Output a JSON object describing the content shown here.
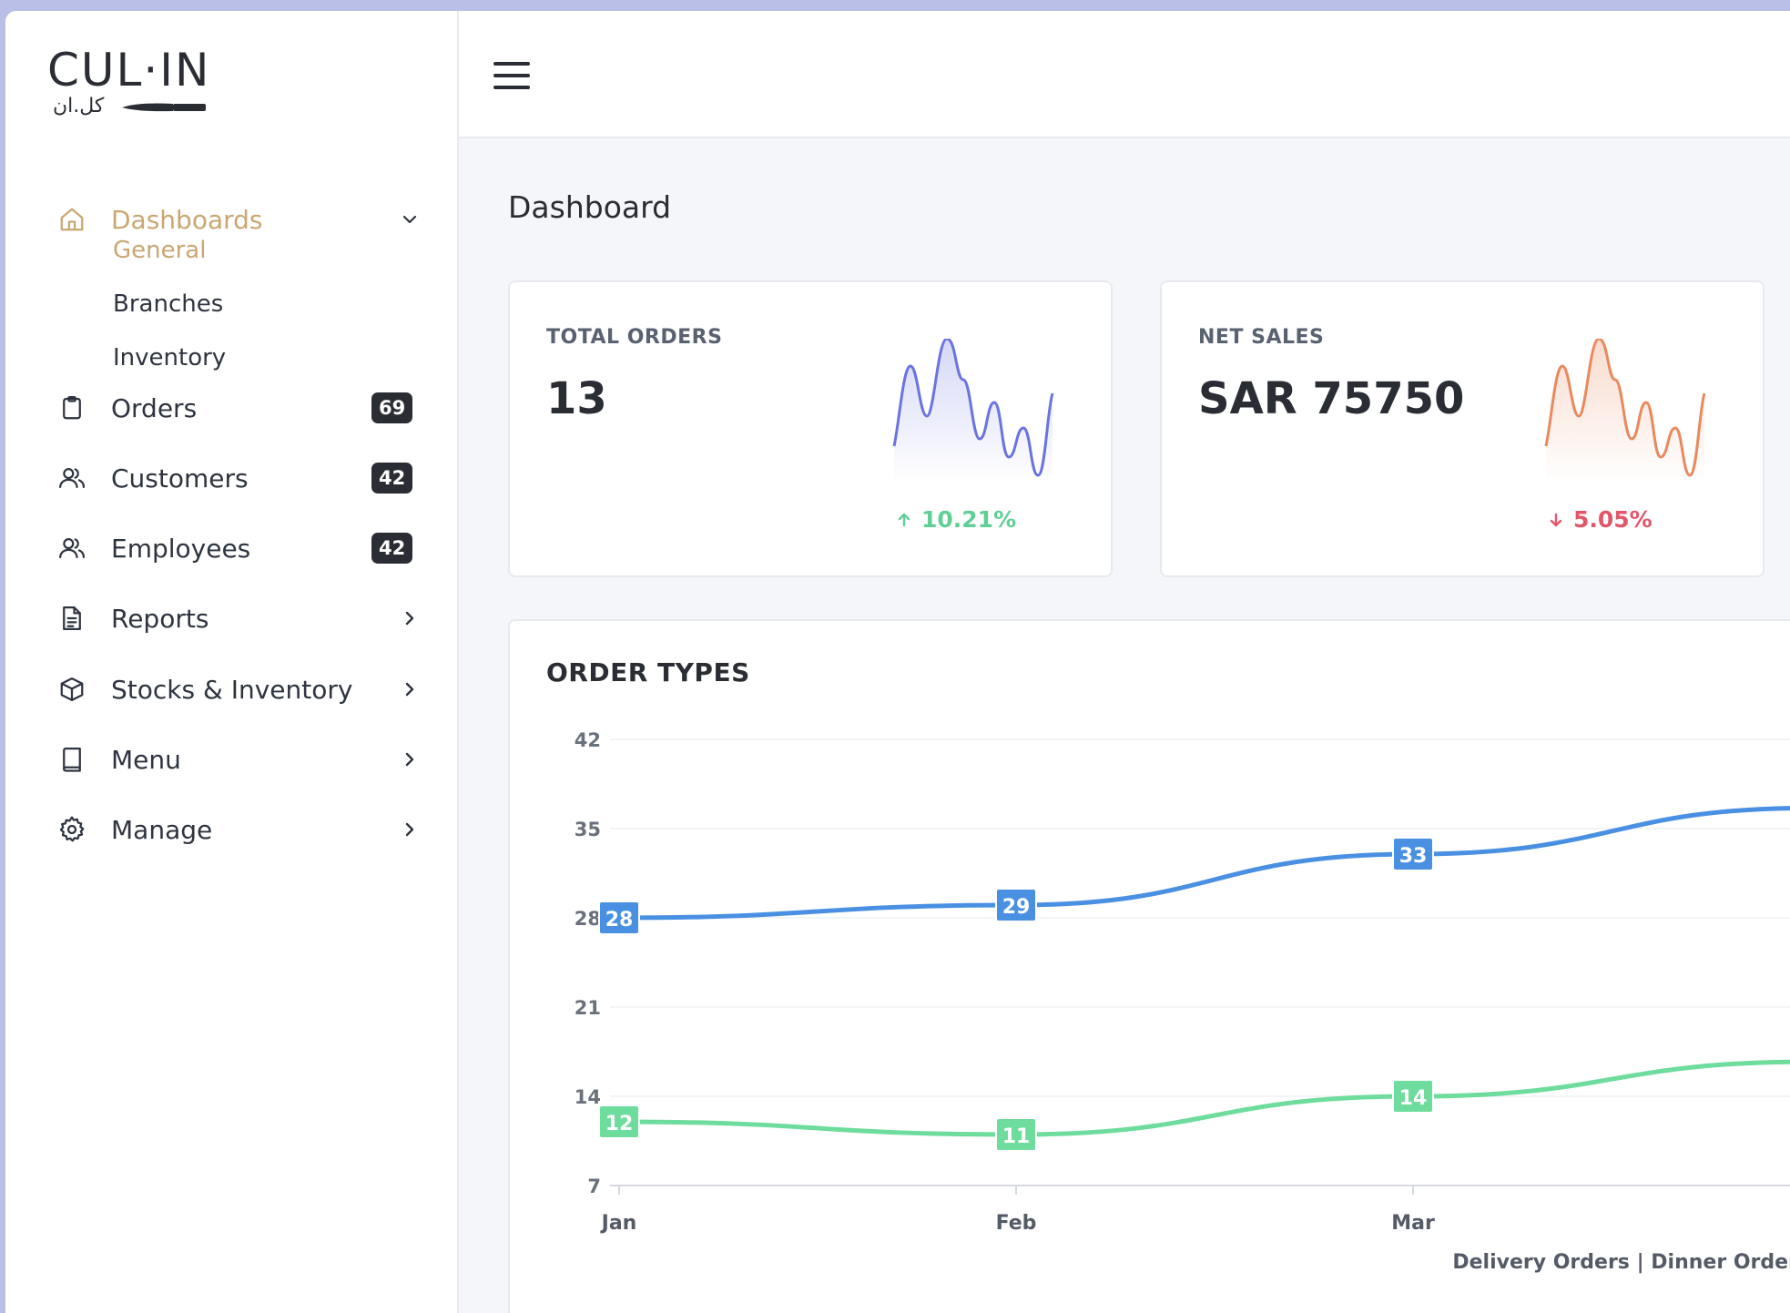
{
  "app": {
    "logo_text": "CUL·IN",
    "logo_subtext": "كل.ان"
  },
  "sidebar": {
    "dashboards": {
      "label": "Dashboards",
      "icon": "home-icon",
      "children": [
        {
          "label": "General",
          "active": true
        },
        {
          "label": "Branches"
        },
        {
          "label": "Inventory"
        }
      ]
    },
    "items": [
      {
        "label": "Orders",
        "icon": "clipboard-icon",
        "badge": "69"
      },
      {
        "label": "Customers",
        "icon": "users-icon",
        "badge": "42"
      },
      {
        "label": "Employees",
        "icon": "users-icon",
        "badge": "42"
      },
      {
        "label": "Reports",
        "icon": "document-icon"
      },
      {
        "label": "Stocks & Inventory",
        "icon": "box-icon"
      },
      {
        "label": "Menu",
        "icon": "book-icon"
      },
      {
        "label": "Manage",
        "icon": "gear-icon"
      }
    ]
  },
  "main": {
    "page_title": "Dashboard",
    "stats": [
      {
        "label": "TOTAL ORDERS",
        "value": "13",
        "trend": "10.21%",
        "direction": "up",
        "color": "#6b73e0"
      },
      {
        "label": "NET SALES",
        "value": "SAR 75750",
        "trend": "5.05%",
        "direction": "down",
        "color": "#e9895e"
      }
    ],
    "order_types": {
      "title": "ORDER TYPES",
      "legend": [
        "Delivery Orders",
        "Dinner Orders"
      ]
    }
  },
  "chart_data": {
    "type": "line",
    "title": "ORDER TYPES",
    "categories": [
      "Jan",
      "Feb",
      "Mar"
    ],
    "y_ticks": [
      42,
      35,
      28,
      21,
      14,
      7
    ],
    "ylim": [
      7,
      42
    ],
    "series": [
      {
        "name": "Delivery Orders",
        "values": [
          28,
          29,
          33
        ],
        "color": "#4a90e2"
      },
      {
        "name": "Dinner Orders",
        "values": [
          12,
          11,
          14
        ],
        "color": "#6ddc9c"
      }
    ]
  },
  "colors": {
    "accent": "#c9a772",
    "badge_bg": "#2a2d33",
    "trend_up": "#5fcf95",
    "trend_down": "#e3566a"
  }
}
